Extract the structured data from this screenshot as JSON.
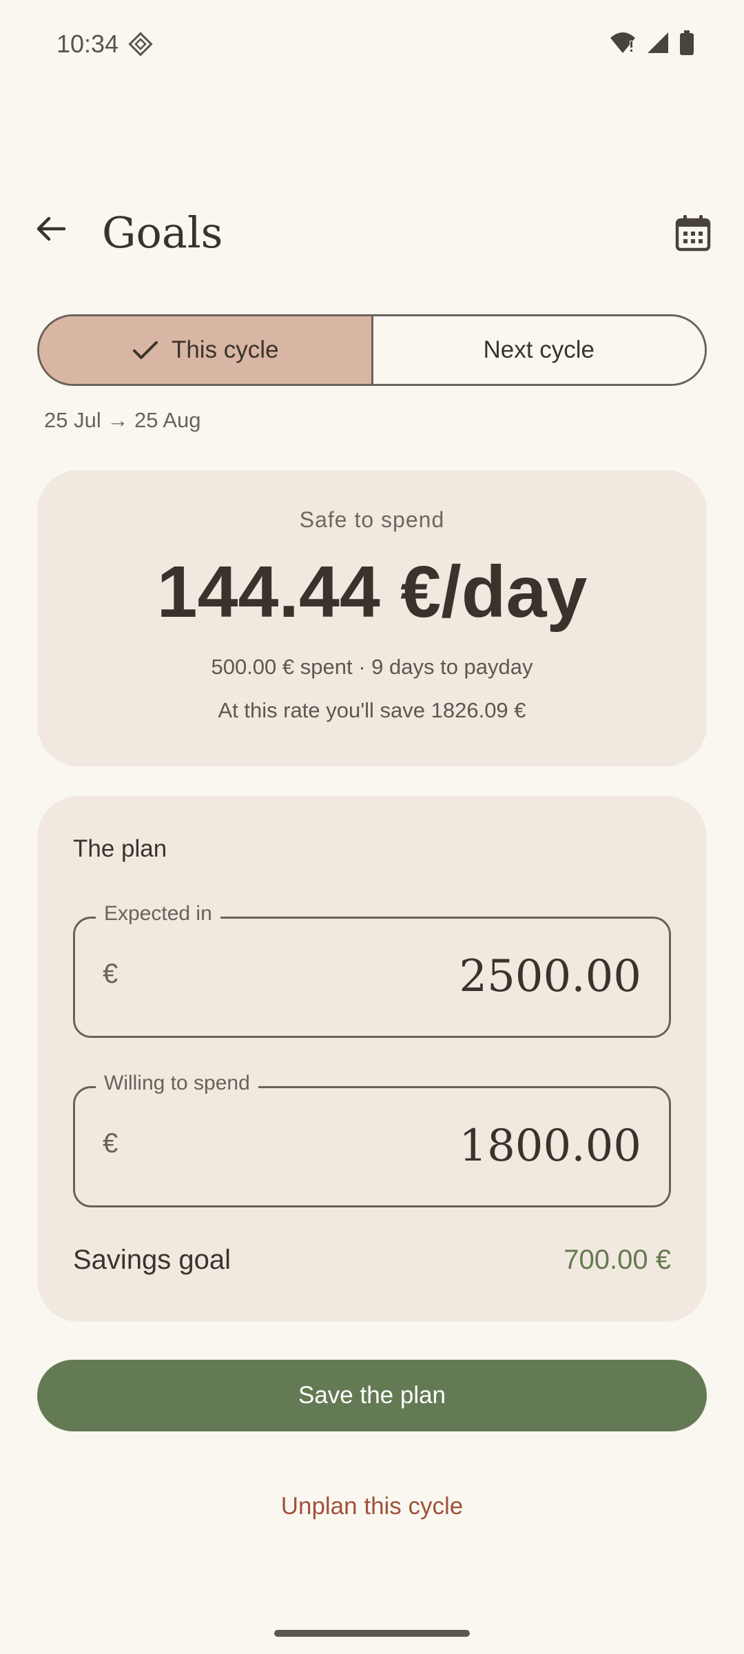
{
  "status_bar": {
    "time": "10:34"
  },
  "app_bar": {
    "title": "Goals"
  },
  "cycle_toggle": {
    "selected_label": "This cycle",
    "other_label": "Next cycle",
    "date_range": "25 Jul → 25 Aug"
  },
  "summary": {
    "label": "Safe to spend",
    "value": "144.44 €/day",
    "spent_line": "500.00 € spent · 9 days to payday",
    "save_line": "At this rate you'll save 1826.09 €"
  },
  "plan": {
    "title": "The plan",
    "expected_in": {
      "label": "Expected in",
      "prefix": "€",
      "value": "2500.00"
    },
    "willing_to_spend": {
      "label": "Willing to spend",
      "prefix": "€",
      "value": "1800.00"
    },
    "savings_goal": {
      "label": "Savings goal",
      "value": "700.00 €"
    }
  },
  "actions": {
    "save_label": "Save the plan",
    "unplan_label": "Unplan this cycle"
  },
  "colors": {
    "background": "#FAF7F1",
    "card": "#F1E9E0",
    "selected_segment": "#D9B6A3",
    "primary_button": "#647A54",
    "savings_green": "#65794F",
    "destructive_text": "#A0523A"
  }
}
